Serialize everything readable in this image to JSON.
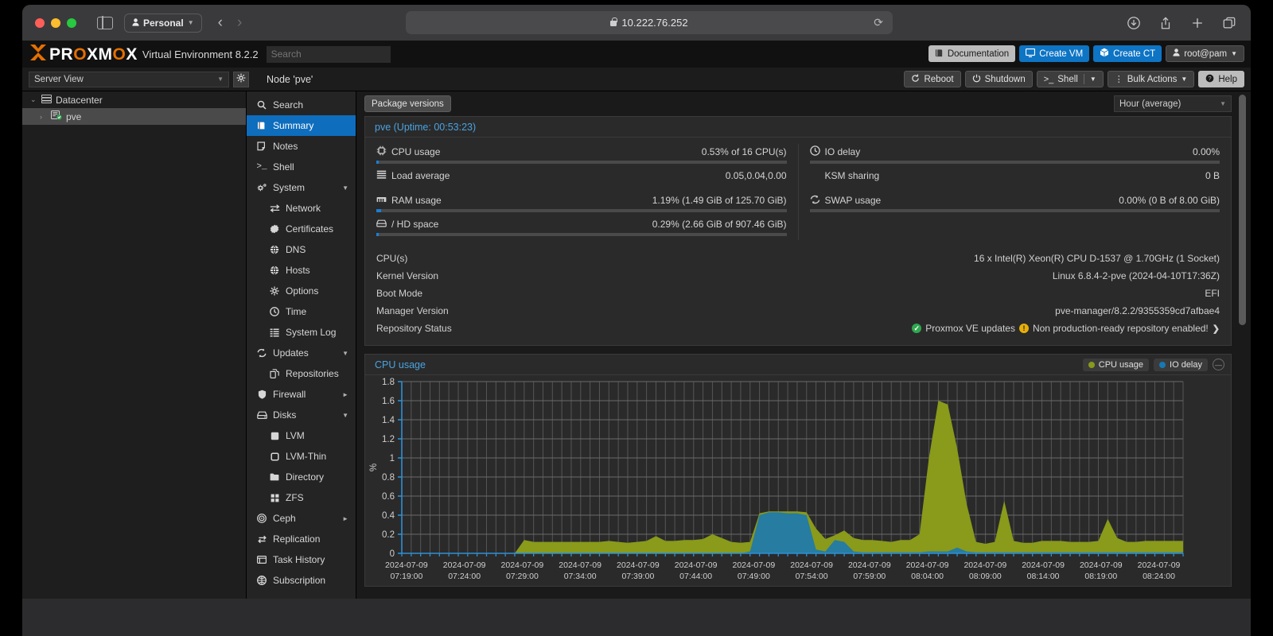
{
  "browser": {
    "profile_label": "Personal",
    "url": "10.222.76.252",
    "back_icon": "chevron-left-icon",
    "forward_icon": "chevron-right-icon",
    "reload_icon": "reload-icon",
    "download_icon": "download-icon",
    "share_icon": "share-icon",
    "newtab_icon": "plus-icon",
    "tabs_icon": "tab-overview-icon"
  },
  "pve_header": {
    "logo_x": "X",
    "logo_pro": "PR",
    "logo_o": "O",
    "logo_xm": "XM",
    "logo_o2": "O",
    "logo_x2": "X",
    "product": "Virtual Environment 8.2.2",
    "search_placeholder": "Search",
    "documentation": "Documentation",
    "create_vm": "Create VM",
    "create_ct": "Create CT",
    "user": "root@pam"
  },
  "subbar": {
    "view_select": "Server View",
    "node_title": "Node 'pve'",
    "reboot": "Reboot",
    "shutdown": "Shutdown",
    "shell": "Shell",
    "bulk_actions": "Bulk Actions",
    "help": "Help"
  },
  "tree": {
    "datacenter": "Datacenter",
    "node": "pve"
  },
  "nav": {
    "items": [
      {
        "label": "Search",
        "icon": "search-icon",
        "level": 0,
        "active": false,
        "caret": ""
      },
      {
        "label": "Summary",
        "icon": "summary-icon",
        "level": 0,
        "active": true,
        "caret": ""
      },
      {
        "label": "Notes",
        "icon": "notes-icon",
        "level": 0,
        "active": false,
        "caret": ""
      },
      {
        "label": "Shell",
        "icon": "terminal-icon",
        "level": 0,
        "active": false,
        "caret": ""
      },
      {
        "label": "System",
        "icon": "system-gears-icon",
        "level": 0,
        "active": false,
        "caret": "▼"
      },
      {
        "label": "Network",
        "icon": "network-icon",
        "level": 1,
        "active": false,
        "caret": ""
      },
      {
        "label": "Certificates",
        "icon": "certificate-icon",
        "level": 1,
        "active": false,
        "caret": ""
      },
      {
        "label": "DNS",
        "icon": "globe-icon",
        "level": 1,
        "active": false,
        "caret": ""
      },
      {
        "label": "Hosts",
        "icon": "globe-icon",
        "level": 1,
        "active": false,
        "caret": ""
      },
      {
        "label": "Options",
        "icon": "gear-icon",
        "level": 1,
        "active": false,
        "caret": ""
      },
      {
        "label": "Time",
        "icon": "clock-icon",
        "level": 1,
        "active": false,
        "caret": ""
      },
      {
        "label": "System Log",
        "icon": "list-icon",
        "level": 1,
        "active": false,
        "caret": ""
      },
      {
        "label": "Updates",
        "icon": "refresh-icon",
        "level": 0,
        "active": false,
        "caret": "▼"
      },
      {
        "label": "Repositories",
        "icon": "repositories-icon",
        "level": 1,
        "active": false,
        "caret": ""
      },
      {
        "label": "Firewall",
        "icon": "shield-icon",
        "level": 0,
        "active": false,
        "caret": "►"
      },
      {
        "label": "Disks",
        "icon": "disk-icon",
        "level": 0,
        "active": false,
        "caret": "▼"
      },
      {
        "label": "LVM",
        "icon": "lvm-icon",
        "level": 1,
        "active": false,
        "caret": ""
      },
      {
        "label": "LVM-Thin",
        "icon": "lvm-thin-icon",
        "level": 1,
        "active": false,
        "caret": ""
      },
      {
        "label": "Directory",
        "icon": "folder-icon",
        "level": 1,
        "active": false,
        "caret": ""
      },
      {
        "label": "ZFS",
        "icon": "zfs-icon",
        "level": 1,
        "active": false,
        "caret": ""
      },
      {
        "label": "Ceph",
        "icon": "ceph-icon",
        "level": 0,
        "active": false,
        "caret": "►"
      },
      {
        "label": "Replication",
        "icon": "replication-icon",
        "level": 0,
        "active": false,
        "caret": ""
      },
      {
        "label": "Task History",
        "icon": "task-history-icon",
        "level": 0,
        "active": false,
        "caret": ""
      },
      {
        "label": "Subscription",
        "icon": "subscription-icon",
        "level": 0,
        "active": false,
        "caret": ""
      }
    ]
  },
  "content": {
    "package_versions_button": "Package versions",
    "period_select": "Hour (average)",
    "status_title": "pve (Uptime: 00:53:23)",
    "metrics_left": [
      {
        "label": "CPU usage",
        "icon": "cpu-icon",
        "value": "0.53% of 16 CPU(s)",
        "bar": 0.53
      },
      {
        "label": "Load average",
        "icon": "load-icon",
        "value": "0.05,0.04,0.00",
        "bar": null
      },
      {
        "label": "RAM usage",
        "icon": "ram-icon",
        "value": "1.19% (1.49 GiB of 125.70 GiB)",
        "bar": 1.19
      },
      {
        "label": "/ HD space",
        "icon": "hdd-icon",
        "value": "0.29% (2.66 GiB of 907.46 GiB)",
        "bar": 0.29
      }
    ],
    "metrics_right": [
      {
        "label": "IO delay",
        "icon": "iodelay-icon",
        "value": "0.00%",
        "bar": 0
      },
      {
        "label": "KSM sharing",
        "icon": "",
        "value": "0 B",
        "bar": null
      },
      {
        "label": "SWAP usage",
        "icon": "swap-icon",
        "value": "0.00% (0 B of 8.00 GiB)",
        "bar": 0
      }
    ],
    "info_rows": [
      {
        "label": "CPU(s)",
        "value": "16 x Intel(R) Xeon(R) CPU D-1537 @ 1.70GHz (1 Socket)"
      },
      {
        "label": "Kernel Version",
        "value": "Linux 6.8.4-2-pve (2024-04-10T17:36Z)"
      },
      {
        "label": "Boot Mode",
        "value": "EFI"
      },
      {
        "label": "Manager Version",
        "value": "pve-manager/8.2.2/9355359cd7afbae4"
      }
    ],
    "repo_status_label": "Repository Status",
    "repo_ok_text": "Proxmox VE updates",
    "repo_warn_text": "Non production-ready repository enabled!",
    "repo_arrow": "❯"
  },
  "chart_data": {
    "type": "area",
    "title": "CPU usage",
    "ylabel": "%",
    "xlabel": "",
    "ylim": [
      0,
      1.8
    ],
    "yticks": [
      0,
      0.2,
      0.4,
      0.6,
      0.8,
      1,
      1.2,
      1.4,
      1.6,
      1.8
    ],
    "ytick_labels": [
      "0",
      "0.2",
      "0.4",
      "0.6",
      "0.8",
      "1",
      "1.2",
      "1.4",
      "1.6",
      "1.8"
    ],
    "grid": true,
    "legend_position": "top-right",
    "categories": [
      "2024-07-09 07:19:00",
      "2024-07-09 07:24:00",
      "2024-07-09 07:29:00",
      "2024-07-09 07:34:00",
      "2024-07-09 07:39:00",
      "2024-07-09 07:44:00",
      "2024-07-09 07:49:00",
      "2024-07-09 07:54:00",
      "2024-07-09 07:59:00",
      "2024-07-09 08:04:00",
      "2024-07-09 08:09:00",
      "2024-07-09 08:14:00",
      "2024-07-09 08:19:00",
      "2024-07-09 08:24:00"
    ],
    "x_start_minutes": 13,
    "series": [
      {
        "name": "CPU usage",
        "color": "#8a9a1a",
        "values": [
          0,
          0,
          0,
          0,
          0,
          0,
          0,
          0,
          0,
          0,
          0,
          0,
          0,
          0.14,
          0.12,
          0.12,
          0.12,
          0.12,
          0.12,
          0.12,
          0.12,
          0.12,
          0.13,
          0.12,
          0.11,
          0.12,
          0.13,
          0.18,
          0.13,
          0.13,
          0.14,
          0.14,
          0.15,
          0.2,
          0.16,
          0.12,
          0.11,
          0.12,
          0.42,
          0.44,
          0.44,
          0.44,
          0.44,
          0.43,
          0.26,
          0.15,
          0.19,
          0.24,
          0.16,
          0.14,
          0.14,
          0.13,
          0.12,
          0.14,
          0.14,
          0.2,
          1.0,
          1.6,
          1.56,
          1.1,
          0.52,
          0.12,
          0.1,
          0.12,
          0.55,
          0.13,
          0.11,
          0.11,
          0.13,
          0.13,
          0.13,
          0.12,
          0.12,
          0.12,
          0.13,
          0.36,
          0.16,
          0.12,
          0.12,
          0.13,
          0.13,
          0.13,
          0.13,
          0.13
        ]
      },
      {
        "name": "IO delay",
        "color": "#1878b4",
        "values": [
          0,
          0,
          0,
          0,
          0,
          0,
          0,
          0,
          0,
          0,
          0,
          0,
          0,
          0,
          0,
          0,
          0,
          0,
          0,
          0,
          0,
          0,
          0,
          0,
          0,
          0,
          0,
          0,
          0,
          0,
          0,
          0,
          0,
          0,
          0,
          0,
          0,
          0.02,
          0.4,
          0.43,
          0.43,
          0.42,
          0.42,
          0.4,
          0.04,
          0.02,
          0.14,
          0.12,
          0.02,
          0.01,
          0.01,
          0.01,
          0.01,
          0.01,
          0.01,
          0.01,
          0.02,
          0.02,
          0.02,
          0.06,
          0.02,
          0.01,
          0.01,
          0.01,
          0.01,
          0.01,
          0.01,
          0.01,
          0.01,
          0.01,
          0.01,
          0.01,
          0.01,
          0.01,
          0.01,
          0.01,
          0.01,
          0.01,
          0.01,
          0.01,
          0.01,
          0.01,
          0.01,
          0.01
        ]
      }
    ]
  }
}
